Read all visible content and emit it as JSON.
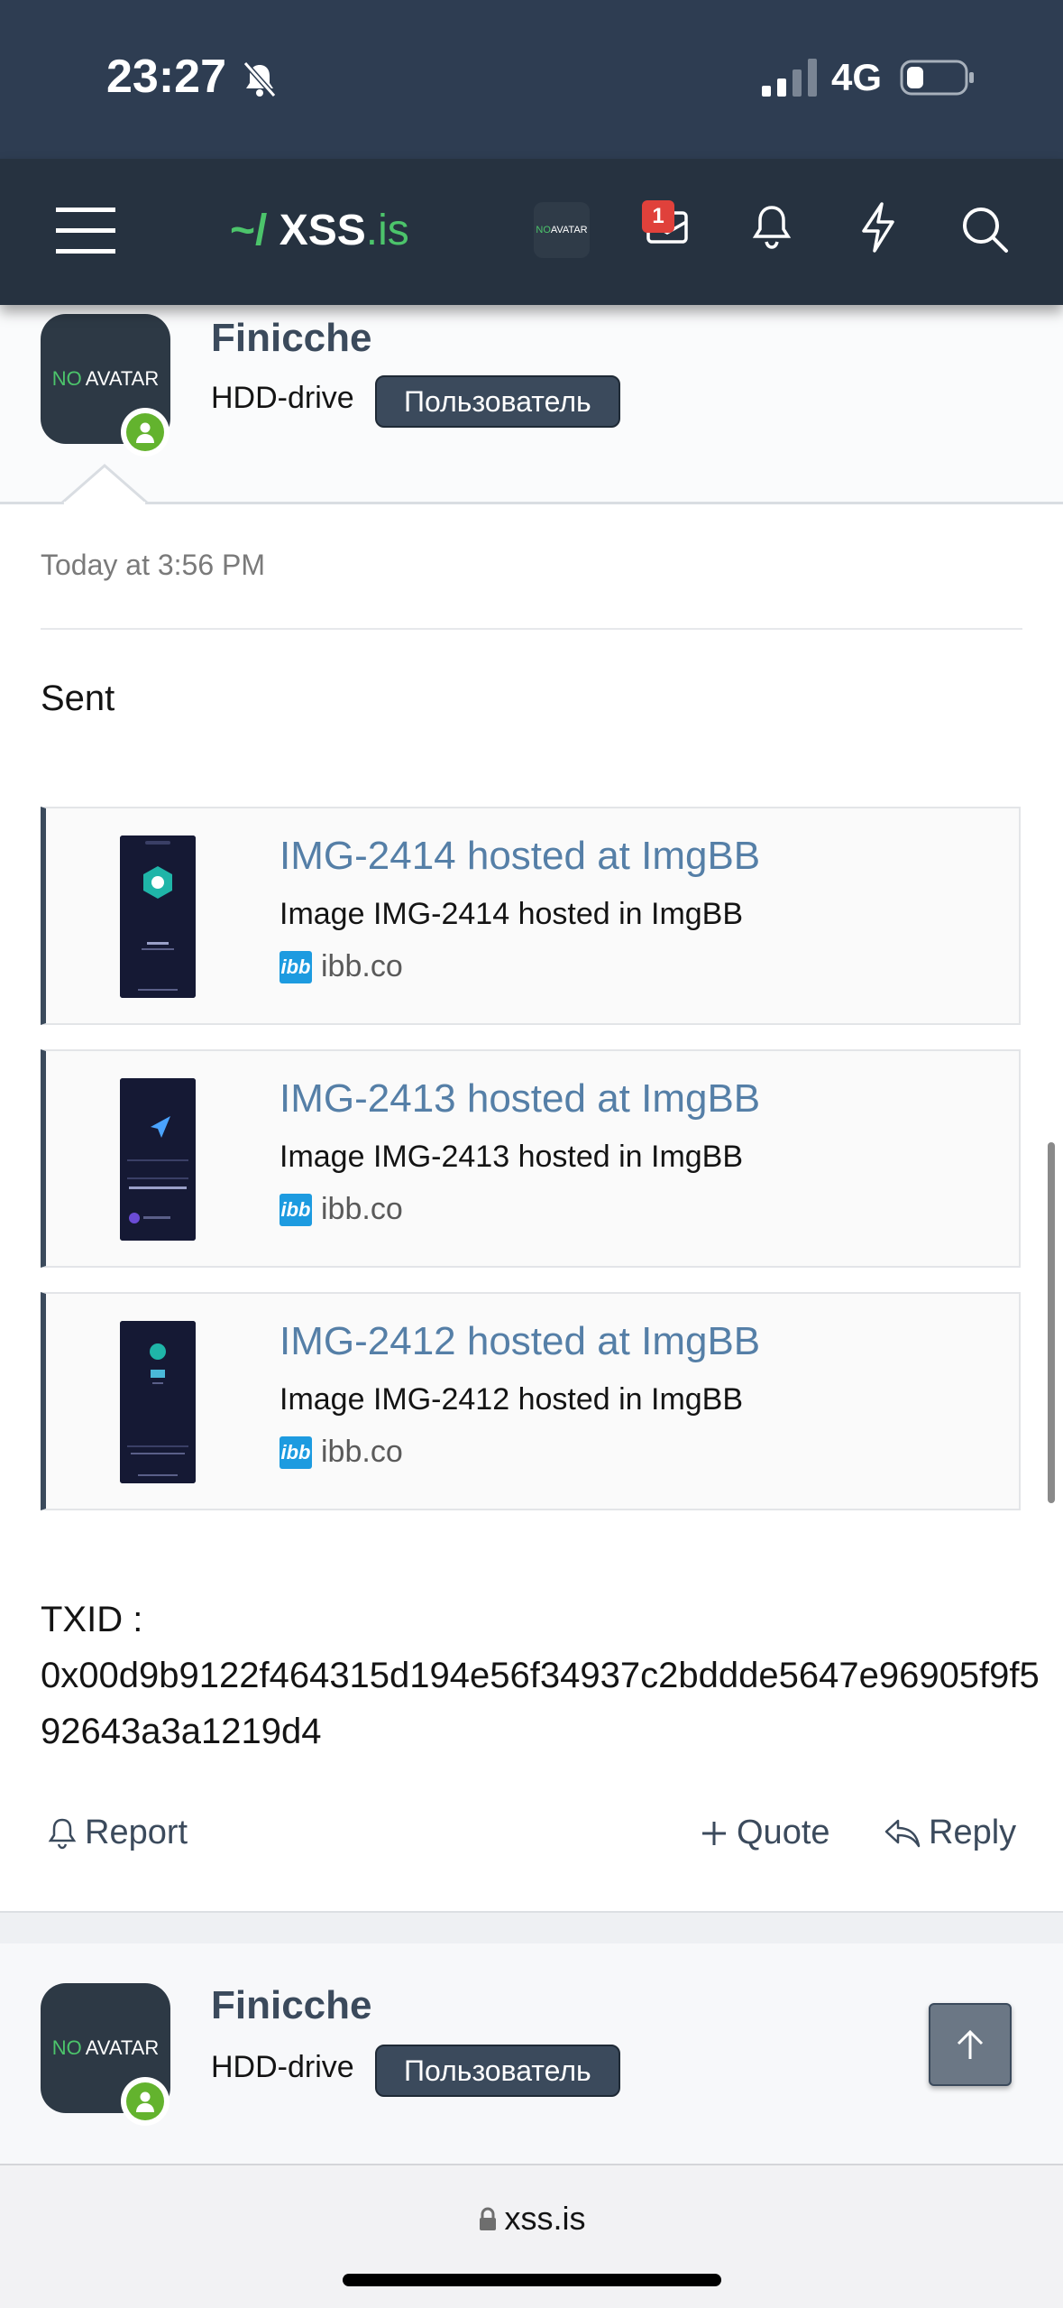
{
  "status": {
    "time": "23:27",
    "network": "4G"
  },
  "nav": {
    "logo_prefix": "~/",
    "logo_name": "XSS",
    "logo_suffix": ".is",
    "avatar_no": "NO",
    "avatar_text": "AVATAR",
    "inbox_badge": "1"
  },
  "post1": {
    "avatar_no": "NO",
    "avatar_text": "AVATAR",
    "username": "Finicche",
    "rank": "HDD-drive",
    "role": "Пользователь",
    "time": "Today at 3:56 PM",
    "body": "Sent",
    "embeds": [
      {
        "title": "IMG-2414 hosted at ImgBB",
        "desc": "Image IMG-2414 hosted in ImgBB",
        "site": "ibb.co"
      },
      {
        "title": "IMG-2413 hosted at ImgBB",
        "desc": "Image IMG-2413 hosted in ImgBB",
        "site": "ibb.co"
      },
      {
        "title": "IMG-2412 hosted at ImgBB",
        "desc": "Image IMG-2412 hosted in ImgBB",
        "site": "ibb.co"
      }
    ],
    "ibb_logo": "ibb",
    "txid_label": "TXID :",
    "txid": "0x00d9b9122f464315d194e56f34937c2bddde5647e96905f9f592643a3a1219d4",
    "actions": {
      "report": "Report",
      "quote": "Quote",
      "reply": "Reply"
    }
  },
  "post2": {
    "avatar_no": "NO",
    "avatar_text": "AVATAR",
    "username": "Finicche",
    "rank": "HDD-drive",
    "role": "Пользователь"
  },
  "browser": {
    "url": "xss.is"
  }
}
